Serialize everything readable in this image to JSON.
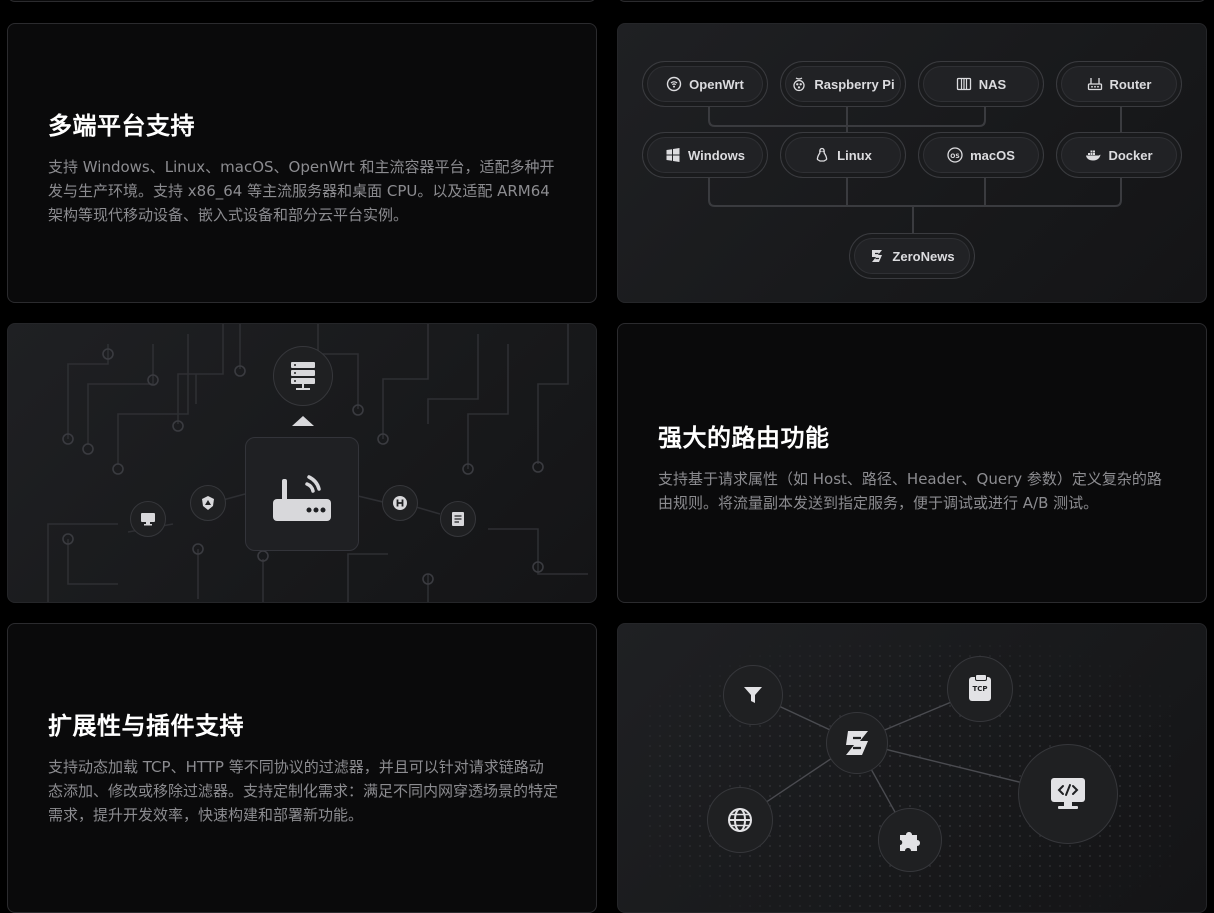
{
  "features": [
    {
      "title": "多端平台支持",
      "description": "支持 Windows、Linux、macOS、OpenWrt 和主流容器平台，适配多种开发与生产环境。支持 x86_64 等主流服务器和桌面 CPU。以及适配 ARM64 架构等现代移动设备、嵌入式设备和部分云平台实例。"
    },
    {
      "title": "强大的路由功能",
      "description": "支持基于请求属性（如 Host、路径、Header、Query 参数）定义复杂的路由规则。将流量副本发送到指定服务，便于调试或进行 A/B 测试。"
    },
    {
      "title": "扩展性与插件支持",
      "description": "支持动态加载 TCP、HTTP 等不同协议的过滤器，并且可以针对请求链路动态添加、修改或移除过滤器。支持定制化需求：满足不同内网穿透场景的特定需求，提升开发效率，快速构建和部署新功能。"
    }
  ],
  "platforms": {
    "row1": [
      {
        "label": "OpenWrt",
        "icon": "openwrt-icon"
      },
      {
        "label": "Raspberry Pi",
        "icon": "raspberry-pi-icon"
      },
      {
        "label": "NAS",
        "icon": "nas-icon"
      },
      {
        "label": "Router",
        "icon": "router-icon"
      }
    ],
    "row2": [
      {
        "label": "Windows",
        "icon": "windows-icon"
      },
      {
        "label": "Linux",
        "icon": "linux-icon"
      },
      {
        "label": "macOS",
        "icon": "macos-icon"
      },
      {
        "label": "Docker",
        "icon": "docker-icon"
      }
    ],
    "hub": {
      "label": "ZeroNews",
      "icon": "zeronews-logo-icon"
    }
  },
  "plugin_nodes": {
    "tcp_label": "TCP",
    "macos_badge": "mac OS"
  },
  "colors": {
    "background": "#000000",
    "card": "#0a0a0b",
    "border": "#2b2b2e",
    "title": "#ffffff",
    "description": "#8c8c90",
    "pill_text": "#dcdcdf"
  }
}
